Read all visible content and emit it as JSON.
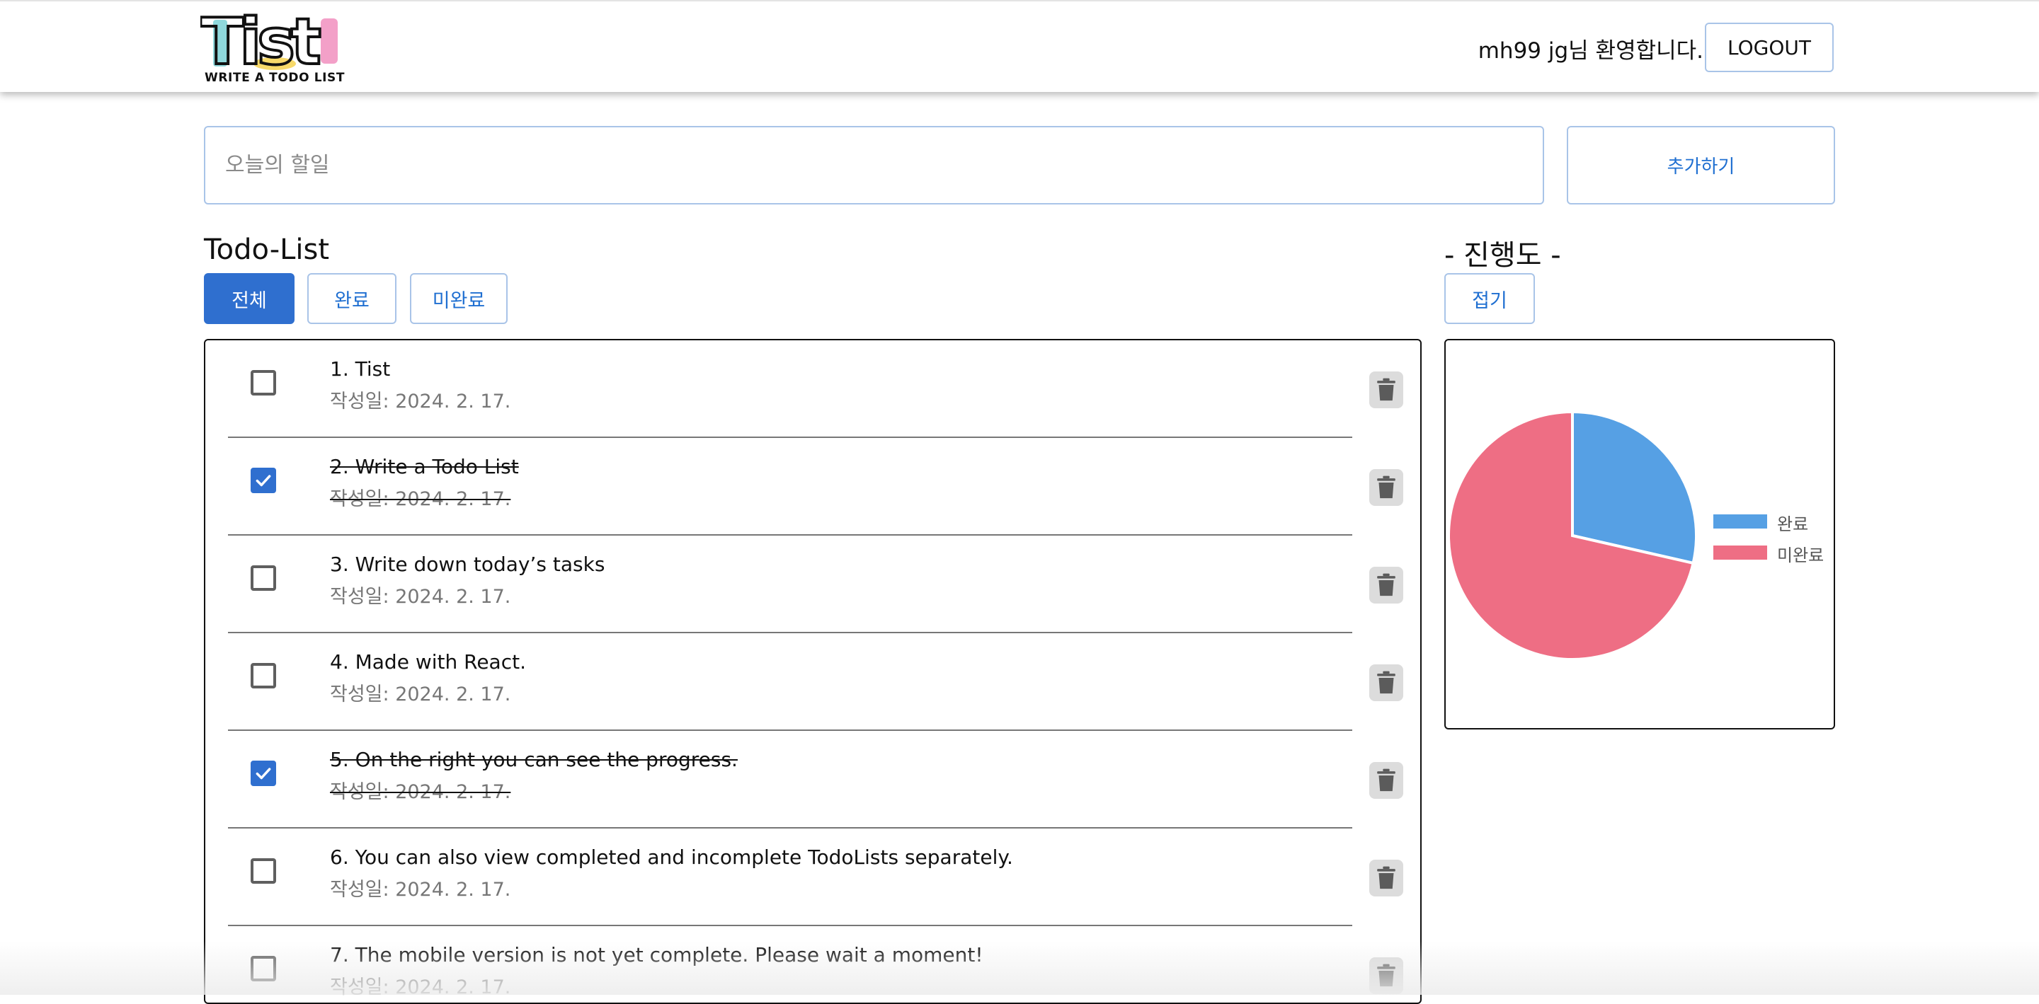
{
  "header": {
    "logo_text": "Tist",
    "logo_subtitle": "WRITE A TODO LIST",
    "welcome": "mh99 jg님 환영합니다.",
    "logout_label": "LOGOUT"
  },
  "input": {
    "placeholder": "오늘의 할일",
    "add_label": "추가하기"
  },
  "todo_section": {
    "title": "Todo-List",
    "filters": [
      {
        "label": "전체",
        "active": true
      },
      {
        "label": "완료",
        "active": false
      },
      {
        "label": "미완료",
        "active": false
      }
    ]
  },
  "todos": [
    {
      "title": "1. Tist",
      "date": "작성일: 2024. 2. 17.",
      "done": false
    },
    {
      "title": "2. Write a Todo List",
      "date": "작성일: 2024. 2. 17.",
      "done": true
    },
    {
      "title": "3. Write down today’s tasks",
      "date": "작성일: 2024. 2. 17.",
      "done": false
    },
    {
      "title": "4. Made with React.",
      "date": "작성일: 2024. 2. 17.",
      "done": false
    },
    {
      "title": "5. On the right you can see the progress.",
      "date": "작성일: 2024. 2. 17.",
      "done": true
    },
    {
      "title": "6. You can also view completed and incomplete TodoLists separately.",
      "date": "작성일: 2024. 2. 17.",
      "done": false
    },
    {
      "title": "7. The mobile version is not yet complete. Please wait a moment!",
      "date": "작성일: 2024. 2. 17.",
      "done": false
    }
  ],
  "progress_section": {
    "title": "- 진행도 -",
    "fold_label": "접기"
  },
  "chart_data": {
    "type": "pie",
    "categories": [
      "완료",
      "미완료"
    ],
    "values": [
      2,
      5
    ],
    "colors": [
      "#56a0e4",
      "#ee6e84"
    ],
    "legend_position": "right"
  },
  "colors": {
    "primary": "#2f6fcf",
    "border": "#a9c4e8",
    "completed": "#56a0e4",
    "incomplete": "#ee6e84"
  },
  "icons": {
    "checkbox_checked": "check-icon",
    "delete": "trash-icon"
  }
}
